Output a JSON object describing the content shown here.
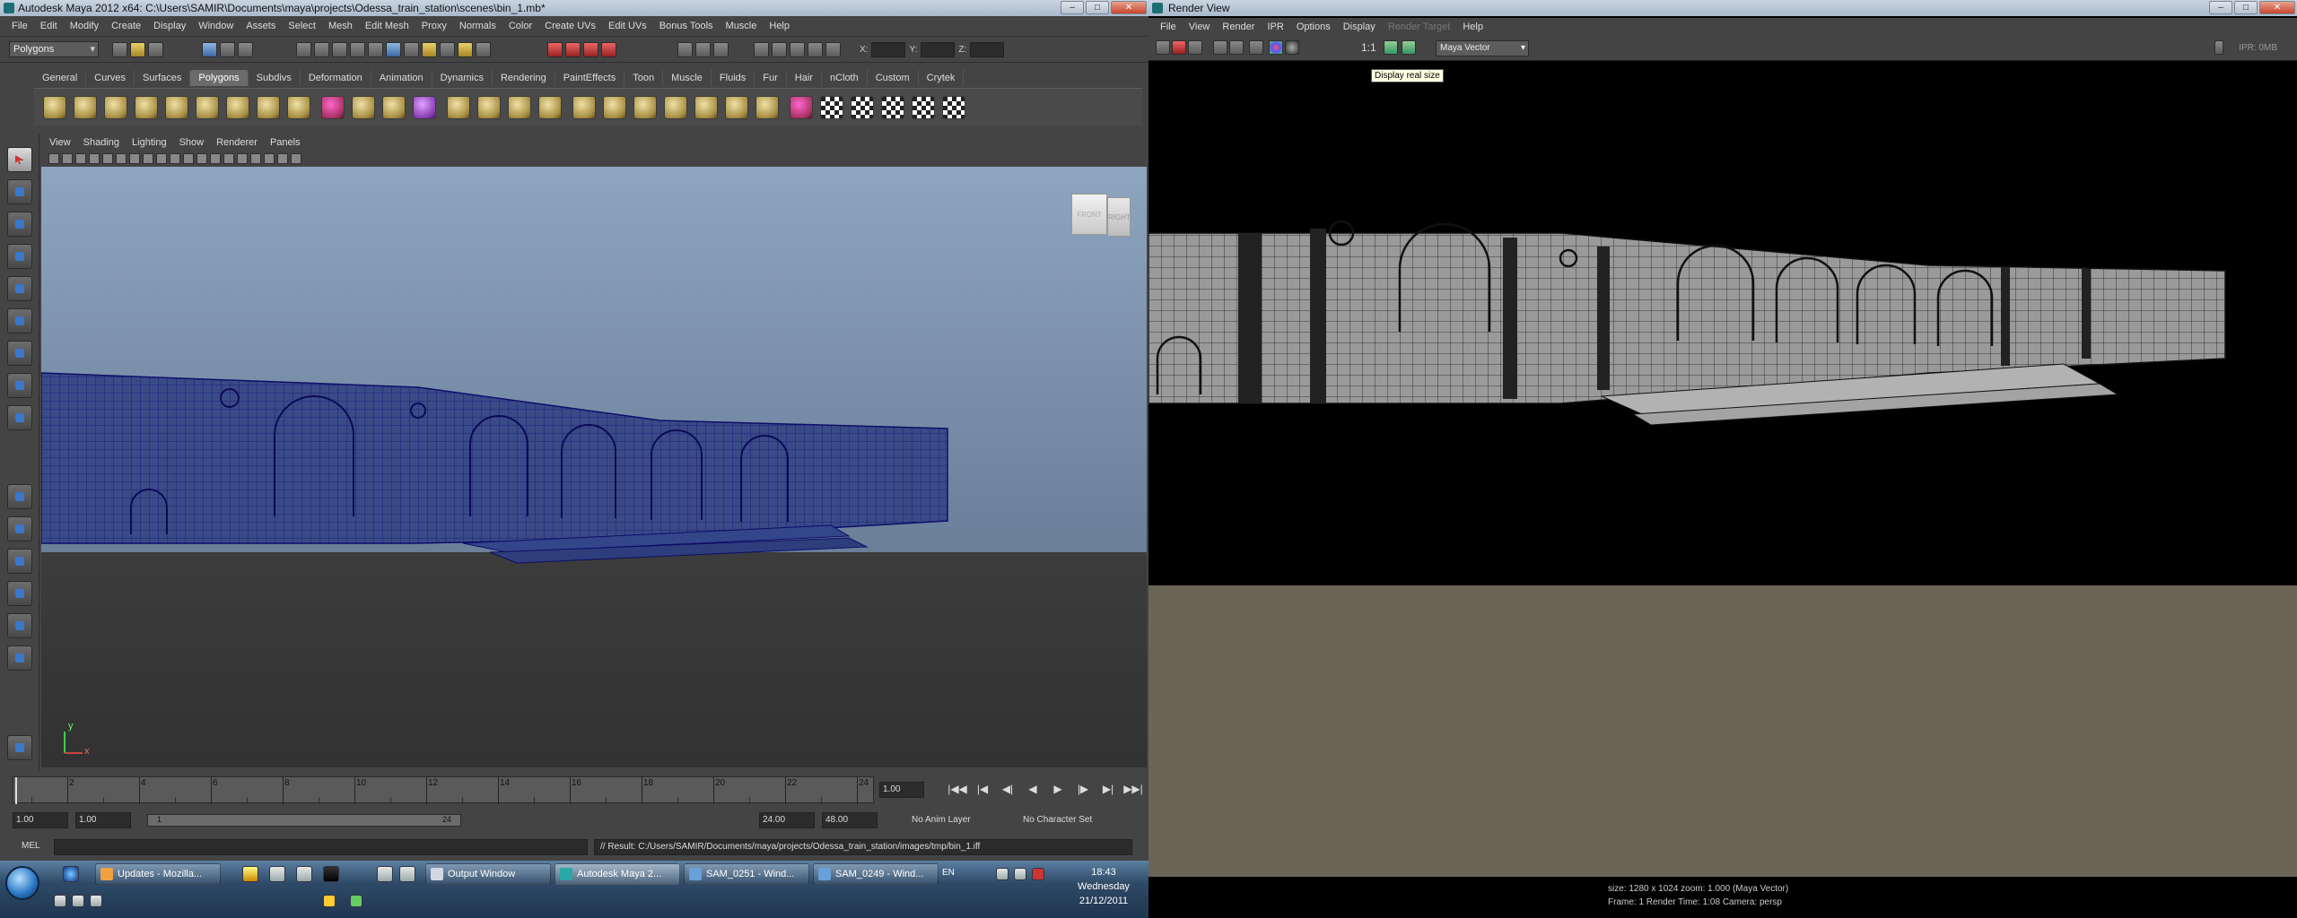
{
  "maya": {
    "title": "Autodesk Maya 2012 x64: C:\\Users\\SAMIR\\Documents\\maya\\projects\\Odessa_train_station\\scenes\\bin_1.mb*",
    "window_buttons": {
      "min": "–",
      "max": "□",
      "close": "✕"
    },
    "menu": [
      "File",
      "Edit",
      "Modify",
      "Create",
      "Display",
      "Window",
      "Assets",
      "Select",
      "Mesh",
      "Edit Mesh",
      "Proxy",
      "Normals",
      "Color",
      "Create UVs",
      "Edit UVs",
      "Bonus Tools",
      "Muscle",
      "Help"
    ],
    "mode": "Polygons",
    "xyz": {
      "x": "X:",
      "y": "Y:",
      "z": "Z:"
    },
    "shelf_tabs": [
      "General",
      "Curves",
      "Surfaces",
      "Polygons",
      "Subdivs",
      "Deformation",
      "Animation",
      "Dynamics",
      "Rendering",
      "PaintEffects",
      "Toon",
      "Muscle",
      "Fluids",
      "Fur",
      "Hair",
      "nCloth",
      "Custom",
      "Crytek"
    ],
    "active_shelf": "Polygons",
    "panel_menu": [
      "View",
      "Shading",
      "Lighting",
      "Show",
      "Renderer",
      "Panels"
    ],
    "viewcube": {
      "front": "FRONT",
      "right": "RIGHT"
    },
    "axes": {
      "y": "y",
      "x": "x"
    },
    "timeline": {
      "ticks": [
        "2",
        "4",
        "6",
        "8",
        "10",
        "12",
        "14",
        "16",
        "18",
        "20",
        "22",
        "24"
      ],
      "current_frame": "1.00"
    },
    "playback": [
      "|◀◀",
      "|◀",
      "◀|",
      "◀",
      "▶",
      "|▶",
      "▶|",
      "▶▶|"
    ],
    "range": {
      "start": "1.00",
      "start2": "1.00",
      "slider_start": "1",
      "slider_end": "24",
      "end": "24.00",
      "end2": "48.00",
      "anim_layer": "No Anim Layer",
      "char_set": "No Character Set"
    },
    "command": {
      "label": "MEL",
      "result": "// Result: C:/Users/SAMIR/Documents/maya/projects/Odessa_train_station/images/tmp/bin_1.iff"
    }
  },
  "render_view": {
    "title": "Render View",
    "menu": [
      "File",
      "View",
      "Render",
      "IPR",
      "Options",
      "Display",
      "Render Target",
      "Help"
    ],
    "disabled_menu": "Render Target",
    "one_to_one": "1:1",
    "renderer": "Maya Vector",
    "ipr_status": "IPR: 0MB",
    "tooltip": "Display real size",
    "info_line1": "size: 1280 x 1024 zoom: 1.000    (Maya Vector)",
    "info_line2": "Frame: 1      Render Time: 1:08      Camera: persp"
  },
  "taskbar": {
    "buttons": [
      {
        "label": "Updates - Mozilla...",
        "color": "#f08a24"
      },
      {
        "label": "Output Window",
        "color": "#cfd8e3"
      },
      {
        "label": "Autodesk Maya 2...",
        "color": "#2aa7a7",
        "active": true
      },
      {
        "label": "SAM_0251 - Wind...",
        "color": "#6aa0d8"
      },
      {
        "label": "SAM_0249 - Wind...",
        "color": "#6aa0d8"
      }
    ],
    "language": "EN",
    "clock": {
      "time": "18:43",
      "day": "Wednesday",
      "date": "21/12/2011"
    }
  },
  "colors": {
    "maya_bg": "#444444",
    "viewport_sky": "#8ea5bf",
    "wireframe": "#1a1a8c",
    "render_ground": "#6b6558",
    "shelf_active": "#6b6b6b"
  }
}
